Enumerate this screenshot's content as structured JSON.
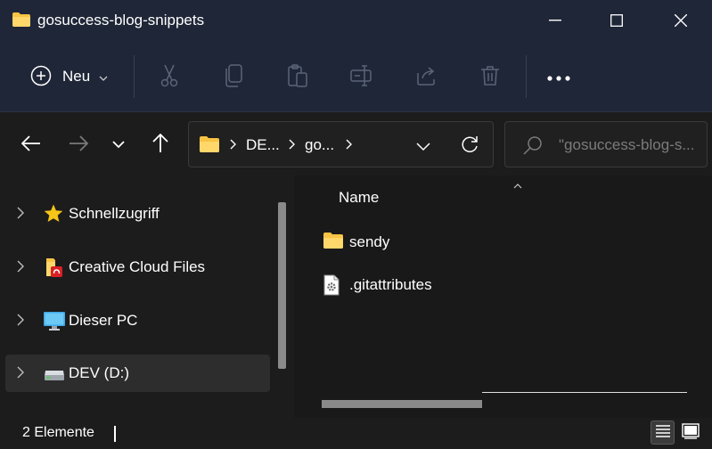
{
  "window": {
    "title": "gosuccess-blog-snippets"
  },
  "toolbar": {
    "new_label": "Neu"
  },
  "address": {
    "crumbs": [
      "DE...",
      "go..."
    ]
  },
  "search": {
    "placeholder": "\"gosuccess-blog-s..."
  },
  "sidebar": {
    "items": [
      {
        "label": "Schnellzugriff",
        "icon": "star-icon"
      },
      {
        "label": "Creative Cloud Files",
        "icon": "creative-cloud-folder-icon"
      },
      {
        "label": "Dieser PC",
        "icon": "monitor-icon"
      },
      {
        "label": "DEV (D:)",
        "icon": "drive-icon",
        "selected": true
      }
    ]
  },
  "content": {
    "column_header": "Name",
    "files": [
      {
        "name": "sendy",
        "icon": "folder-icon"
      },
      {
        "name": ".gitattributes",
        "icon": "settings-file-icon"
      }
    ]
  },
  "status": {
    "count_text": "2 Elemente"
  },
  "colors": {
    "chrome_bg": "#1f2637",
    "body_bg": "#1c1c1c",
    "folder_yellow": "#f8c445",
    "selected_bg": "#2d2d2d"
  }
}
